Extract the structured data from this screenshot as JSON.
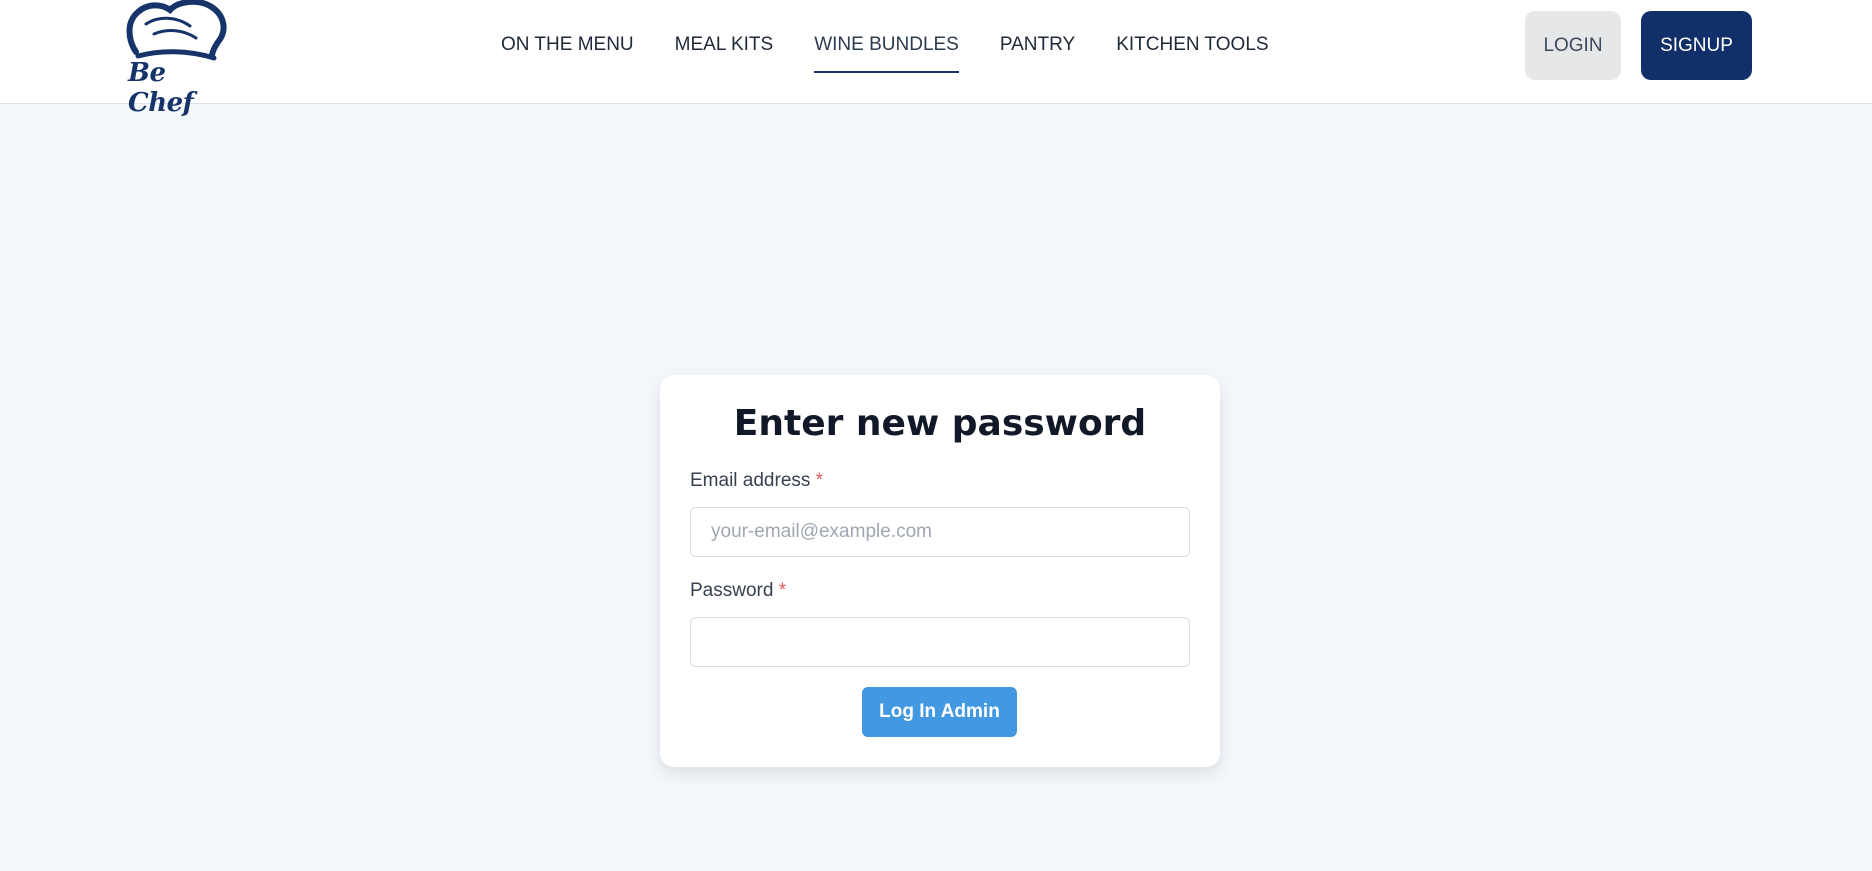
{
  "brand": {
    "name": "Be Chef"
  },
  "nav": {
    "items": [
      {
        "label": "ON THE MENU"
      },
      {
        "label": "MEAL KITS"
      },
      {
        "label": "WINE BUNDLES",
        "active": true
      },
      {
        "label": "PANTRY"
      },
      {
        "label": "KITCHEN TOOLS"
      }
    ],
    "login_label": "LOGIN",
    "signup_label": "SIGNUP"
  },
  "form": {
    "title": "Enter new password",
    "email": {
      "label": "Email address",
      "required_mark": "*",
      "placeholder": "your-email@example.com",
      "value": ""
    },
    "password": {
      "label": "Password",
      "required_mark": "*",
      "value": ""
    },
    "submit_label": "Log In Admin"
  },
  "colors": {
    "brand_navy": "#11306a",
    "accent_blue": "#4299e1",
    "page_bg": "#f5f8fb",
    "required_red": "#e25c5c"
  },
  "icons": {
    "logo": "chef-hat-icon"
  }
}
